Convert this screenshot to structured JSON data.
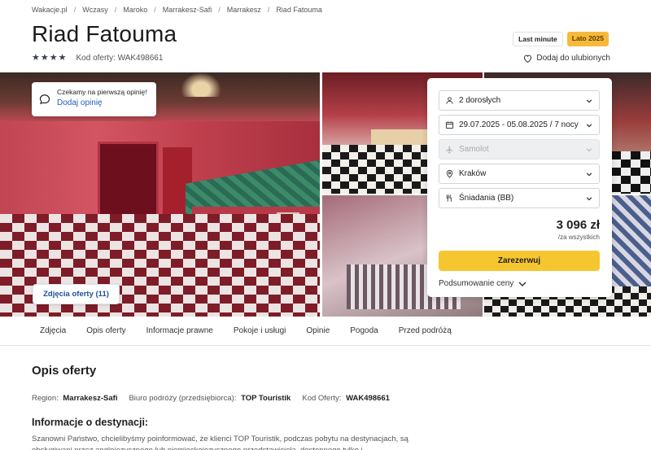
{
  "breadcrumb": [
    "Wakacje.pl",
    "Wczasy",
    "Maroko",
    "Marrakesz-Safi",
    "Marrakesz",
    "Riad Fatouma"
  ],
  "hotel": {
    "name": "Riad Fatouma",
    "stars": 4,
    "offer_code_label": "Kod oferty: WAK498661"
  },
  "badges": {
    "last_minute": "Last minute",
    "season": "Lato 2025"
  },
  "favorite": {
    "label": "Dodaj do ulubionych"
  },
  "opinion_card": {
    "text": "Czekamy na pierwszą opinię!",
    "link": "Dodaj opinię"
  },
  "photos_button": "Zdjęcia oferty (11)",
  "booking": {
    "travelers": "2 dorosłych",
    "dates": "29.07.2025 - 05.08.2025 / 7 nocy",
    "transport": "Samolot",
    "departure": "Kraków",
    "board": "Śniadania (BB)",
    "price": "3 096 zł",
    "price_note": "/za wszystkich",
    "reserve_label": "Zarezerwuj",
    "summary_label": "Podsumowanie ceny"
  },
  "tabs": [
    "Zdjęcia",
    "Opis oferty",
    "Informacje prawne",
    "Pokoje i usługi",
    "Opinie",
    "Pogoda",
    "Przed podróżą"
  ],
  "description": {
    "title": "Opis oferty",
    "region_label": "Region:",
    "region_value": "Marrakesz-Safi",
    "operator_label": "Biuro podróży (przedsiębiorca):",
    "operator_value": "TOP Touristik",
    "code_label": "Kod Oferty:",
    "code_value": "WAK498661",
    "destination_title": "Informacje o destynacji:",
    "destination_text": "Szanowni Państwo, chcielibyśmy poinformować, że klienci TOP Touristik, podczas pobytu na destynacjach, są obsługiwani przez anglojęzycznego lub niemieckojęzycznego przedstawiciela, dostępnego tylko i"
  },
  "colors": {
    "accent": "#f6c630",
    "link": "#1f5fbf",
    "season_badge": "#f6b93b"
  }
}
